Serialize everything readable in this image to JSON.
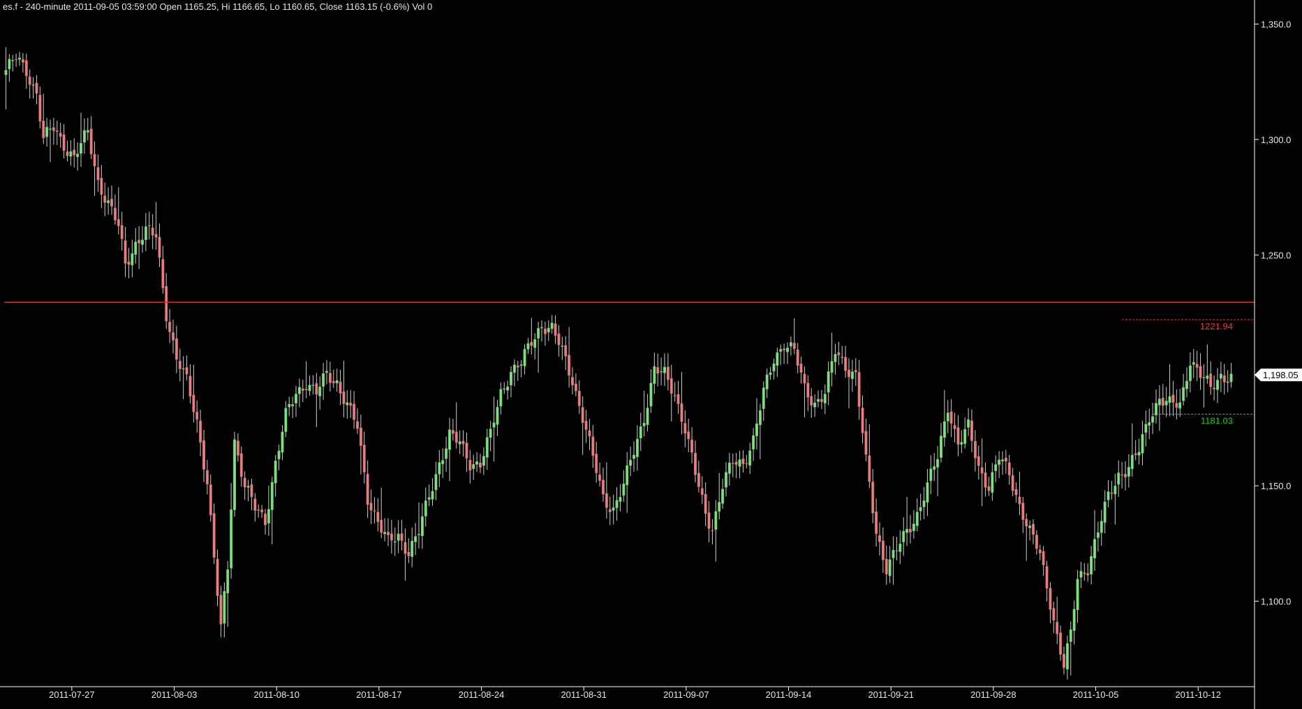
{
  "header": {
    "info": "es.f - 240-minute 2011-09-05 03:59:00 Open 1165.25, Hi 1166.65, Lo 1160.65, Close 1163.15 (-0.6%) Vol 0"
  },
  "colors": {
    "background": "#000000",
    "up": "#7ee07e",
    "down": "#e88080",
    "wick": "#cfcfcf",
    "axis": "#ffffff",
    "resistance": "#ff2020",
    "upper_level": "#ff3030",
    "lower_level": "#22cc22",
    "price_tag_bg": "#ffffff",
    "price_tag_text": "#000000"
  },
  "chart_data": {
    "type": "candlestick",
    "symbol": "es.f",
    "interval": "240-minute",
    "ylim": [
      1063,
      1358
    ],
    "y_ticks": [
      {
        "value": 1350,
        "label": "1,350.0"
      },
      {
        "value": 1300,
        "label": "1,300.0"
      },
      {
        "value": 1250,
        "label": "1,250.0"
      },
      {
        "value": 1150,
        "label": "1,150.0"
      },
      {
        "value": 1100,
        "label": "1,100.0"
      }
    ],
    "x_ticks": [
      {
        "date": "2011-07-27",
        "bar": 5
      },
      {
        "date": "2011-08-03",
        "bar": 35
      },
      {
        "date": "2011-08-10",
        "bar": 65
      },
      {
        "date": "2011-08-17",
        "bar": 95
      },
      {
        "date": "2011-08-24",
        "bar": 125
      },
      {
        "date": "2011-08-31",
        "bar": 155
      },
      {
        "date": "2011-09-07",
        "bar": 185
      },
      {
        "date": "2011-09-14",
        "bar": 215
      },
      {
        "date": "2011-09-21",
        "bar": 245
      },
      {
        "date": "2011-09-28",
        "bar": 275
      },
      {
        "date": "2011-10-05",
        "bar": 305
      },
      {
        "date": "2011-10-12",
        "bar": 335
      }
    ],
    "bar_count": 360,
    "close_path": [
      [
        0,
        1330
      ],
      [
        3,
        1335
      ],
      [
        6,
        1330
      ],
      [
        9,
        1320
      ],
      [
        11,
        1300
      ],
      [
        14,
        1305
      ],
      [
        17,
        1298
      ],
      [
        20,
        1292
      ],
      [
        24,
        1303
      ],
      [
        27,
        1282
      ],
      [
        30,
        1272
      ],
      [
        33,
        1262
      ],
      [
        35,
        1246
      ],
      [
        38,
        1255
      ],
      [
        41,
        1260
      ],
      [
        44,
        1258
      ],
      [
        47,
        1225
      ],
      [
        50,
        1205
      ],
      [
        53,
        1195
      ],
      [
        56,
        1178
      ],
      [
        59,
        1152
      ],
      [
        61,
        1118
      ],
      [
        63,
        1088
      ],
      [
        65,
        1115
      ],
      [
        67,
        1170
      ],
      [
        70,
        1150
      ],
      [
        73,
        1140
      ],
      [
        76,
        1135
      ],
      [
        79,
        1160
      ],
      [
        82,
        1180
      ],
      [
        85,
        1190
      ],
      [
        88,
        1195
      ],
      [
        91,
        1190
      ],
      [
        94,
        1198
      ],
      [
        97,
        1195
      ],
      [
        100,
        1185
      ],
      [
        103,
        1175
      ],
      [
        106,
        1145
      ],
      [
        109,
        1135
      ],
      [
        112,
        1125
      ],
      [
        115,
        1128
      ],
      [
        118,
        1122
      ],
      [
        121,
        1130
      ],
      [
        124,
        1145
      ],
      [
        127,
        1160
      ],
      [
        130,
        1172
      ],
      [
        133,
        1168
      ],
      [
        136,
        1160
      ],
      [
        139,
        1160
      ],
      [
        142,
        1172
      ],
      [
        145,
        1190
      ],
      [
        148,
        1200
      ],
      [
        151,
        1203
      ],
      [
        154,
        1212
      ],
      [
        157,
        1220
      ],
      [
        160,
        1218
      ],
      [
        163,
        1208
      ],
      [
        166,
        1196
      ],
      [
        169,
        1180
      ],
      [
        172,
        1162
      ],
      [
        175,
        1145
      ],
      [
        178,
        1140
      ],
      [
        181,
        1150
      ],
      [
        184,
        1165
      ],
      [
        187,
        1180
      ],
      [
        190,
        1200
      ],
      [
        193,
        1198
      ],
      [
        196,
        1190
      ],
      [
        199,
        1175
      ],
      [
        202,
        1155
      ],
      [
        205,
        1138
      ],
      [
        207,
        1132
      ],
      [
        210,
        1150
      ],
      [
        213,
        1160
      ],
      [
        216,
        1160
      ],
      [
        219,
        1170
      ],
      [
        222,
        1190
      ],
      [
        225,
        1205
      ],
      [
        228,
        1212
      ],
      [
        231,
        1208
      ],
      [
        234,
        1192
      ],
      [
        237,
        1186
      ],
      [
        240,
        1190
      ],
      [
        243,
        1208
      ],
      [
        246,
        1202
      ],
      [
        249,
        1198
      ],
      [
        252,
        1160
      ],
      [
        255,
        1130
      ],
      [
        258,
        1115
      ],
      [
        261,
        1122
      ],
      [
        264,
        1130
      ],
      [
        267,
        1138
      ],
      [
        270,
        1150
      ],
      [
        273,
        1162
      ],
      [
        276,
        1185
      ],
      [
        279,
        1168
      ],
      [
        282,
        1175
      ],
      [
        285,
        1158
      ],
      [
        288,
        1150
      ],
      [
        291,
        1162
      ],
      [
        294,
        1155
      ],
      [
        297,
        1142
      ],
      [
        300,
        1130
      ],
      [
        303,
        1120
      ],
      [
        306,
        1100
      ],
      [
        308,
        1085
      ],
      [
        310,
        1072
      ],
      [
        312,
        1085
      ],
      [
        314,
        1110
      ],
      [
        317,
        1115
      ],
      [
        320,
        1130
      ],
      [
        323,
        1145
      ],
      [
        326,
        1155
      ],
      [
        329,
        1158
      ],
      [
        332,
        1165
      ],
      [
        335,
        1180
      ],
      [
        338,
        1188
      ],
      [
        341,
        1185
      ],
      [
        344,
        1185
      ],
      [
        347,
        1205
      ],
      [
        350,
        1198
      ],
      [
        353,
        1192
      ],
      [
        356,
        1198
      ]
    ],
    "overlays": {
      "resistance_line": {
        "value": 1229.5
      },
      "upper_level": {
        "value": 1221.94,
        "label": "1221.94",
        "from_bar": 327
      },
      "lower_level": {
        "value": 1181.03,
        "label": "1181.03",
        "from_bar": 336
      },
      "last_price": {
        "value": 1198.05,
        "label": "1,198.05"
      }
    }
  }
}
